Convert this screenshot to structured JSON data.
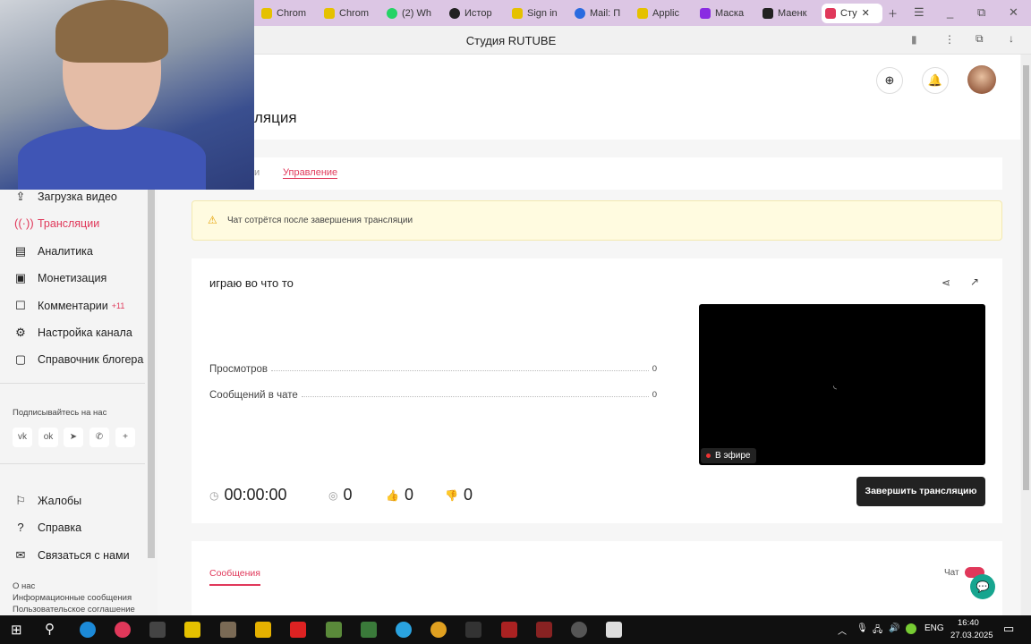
{
  "browser": {
    "tabs": [
      "Chrom",
      "Chrom",
      "(2) Wh",
      "Истор",
      "Sign in",
      "Mail: П",
      "Applic",
      "Маска",
      "Маенк",
      "Сту"
    ],
    "page_title": "Студия RUTUBE"
  },
  "page": {
    "title": "ляция",
    "subtabs": [
      "и",
      "Управление"
    ]
  },
  "sidebar": {
    "items": [
      "Загрузка видео",
      "Трансляции",
      "Аналитика",
      "Монетизация",
      "Комментарии",
      "Настройка канала",
      "Справочник блогера"
    ],
    "comments_badge": "+11",
    "subscribe_label": "Подписывайтесь на нас",
    "social": [
      "vk",
      "ok",
      "telegram",
      "viber",
      "+"
    ],
    "bottom_items": [
      "Жалобы",
      "Справка",
      "Связаться с нами"
    ],
    "footer_links": [
      "О нас",
      "Информационные сообщения",
      "Пользовательское соглашение"
    ]
  },
  "warning": "Чат сотрётся после завершения трансляции",
  "stream": {
    "title": "играю во что то",
    "rows": [
      {
        "label": "Просмотров",
        "value": "0"
      },
      {
        "label": "Сообщений в чате",
        "value": "0"
      }
    ],
    "live_label": "В эфире",
    "end_button": "Завершить трансляцию",
    "duration": "00:00:00",
    "viewers": "0",
    "likes": "0",
    "dislikes": "0"
  },
  "messages": {
    "tab": "Сообщения",
    "chat_label": "Чат"
  },
  "taskbar": {
    "lang": "ENG",
    "time": "16:40",
    "date": "27.03.2025"
  },
  "colors": {
    "accent": "#e0385a"
  }
}
